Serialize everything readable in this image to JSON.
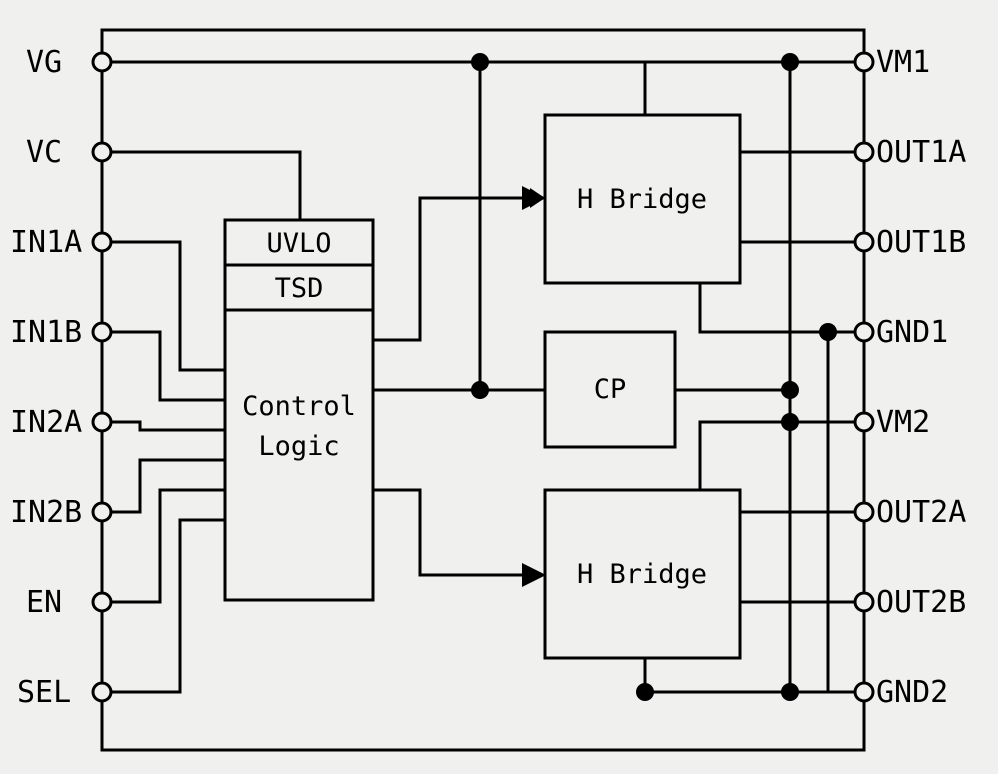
{
  "pins_left": [
    {
      "name": "VG"
    },
    {
      "name": "VC"
    },
    {
      "name": "IN1A"
    },
    {
      "name": "IN1B"
    },
    {
      "name": "IN2A"
    },
    {
      "name": "IN2B"
    },
    {
      "name": "EN"
    },
    {
      "name": "SEL"
    }
  ],
  "pins_right": [
    {
      "name": "VM1"
    },
    {
      "name": "OUT1A"
    },
    {
      "name": "OUT1B"
    },
    {
      "name": "GND1"
    },
    {
      "name": "VM2"
    },
    {
      "name": "OUT2A"
    },
    {
      "name": "OUT2B"
    },
    {
      "name": "GND2"
    }
  ],
  "blocks": {
    "uvlo": "UVLO",
    "tsd": "TSD",
    "control": "Control",
    "logic": "Logic",
    "hbridge1": "H Bridge",
    "hbridge2": "H Bridge",
    "cp": "CP"
  }
}
